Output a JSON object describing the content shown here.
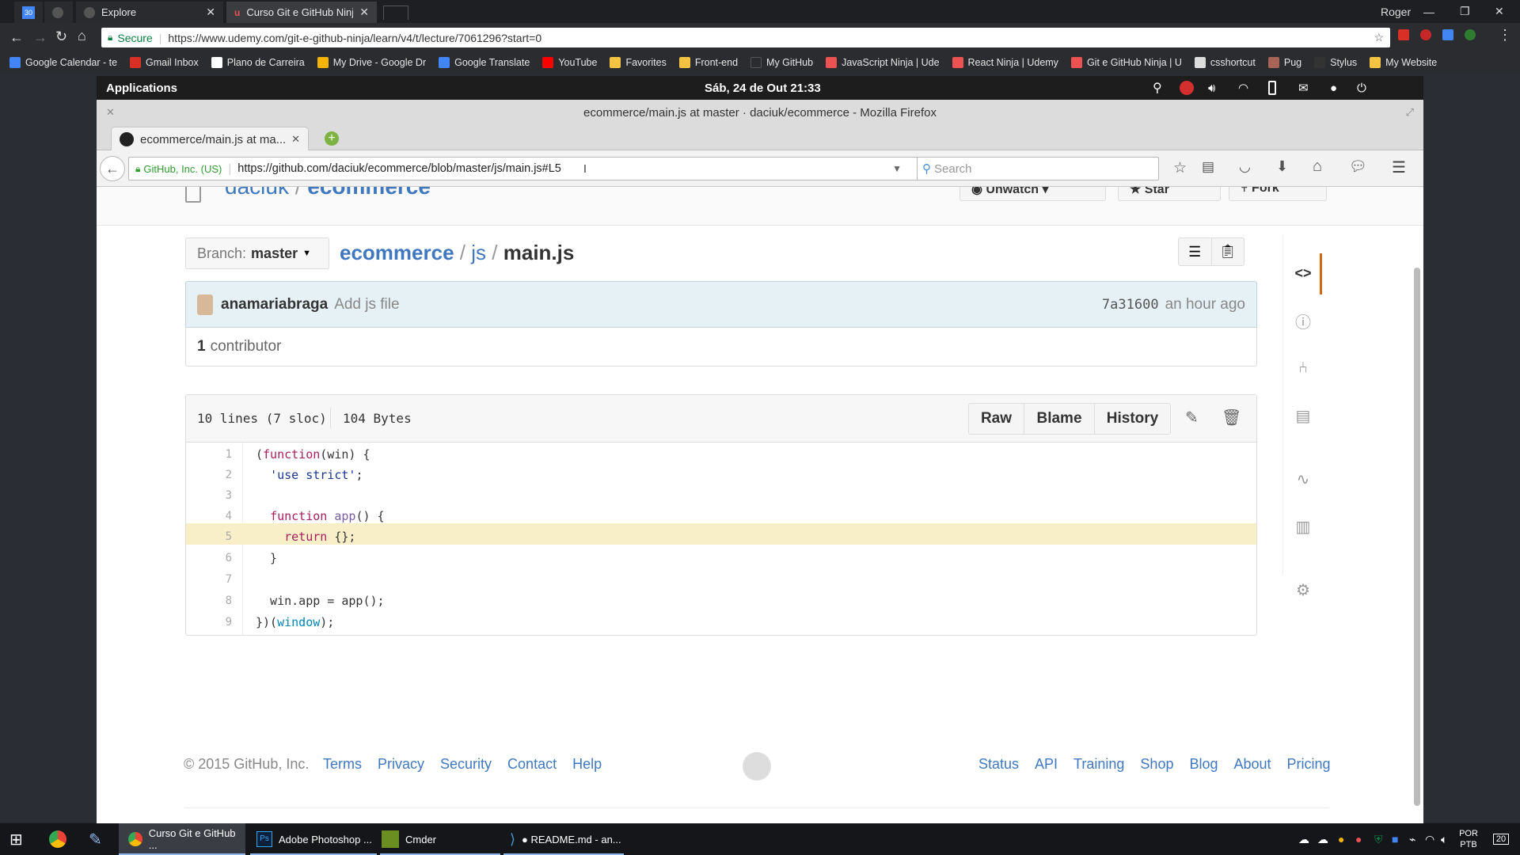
{
  "chrome": {
    "tabs": [
      {
        "label": ""
      },
      {
        "label": ""
      },
      {
        "label": "Explore"
      },
      {
        "label": "Curso Git e GitHub Ninja"
      }
    ],
    "user": "Roger",
    "secure_label": "Secure",
    "url": "https://www.udemy.com/git-e-github-ninja/learn/v4/t/lecture/7061296?start=0",
    "bookmarks": [
      {
        "label": "Google Calendar - te",
        "color": "#4285f4"
      },
      {
        "label": "Gmail Inbox",
        "color": "#d93025"
      },
      {
        "label": "Plano de Carreira",
        "color": "#ffffff"
      },
      {
        "label": "My Drive - Google Dr",
        "color": "#f4b400"
      },
      {
        "label": "Google Translate",
        "color": "#4285f4"
      },
      {
        "label": "YouTube",
        "color": "#ff0000"
      },
      {
        "label": "Favorites",
        "color": "#f5c342"
      },
      {
        "label": "Front-end",
        "color": "#f5c342"
      },
      {
        "label": "My GitHub",
        "color": "#2b2c2f"
      },
      {
        "label": "JavaScript Ninja | Ude",
        "color": "#ec5252"
      },
      {
        "label": "React Ninja | Udemy",
        "color": "#ec5252"
      },
      {
        "label": "Git e GitHub Ninja | U",
        "color": "#ec5252"
      },
      {
        "label": "csshortcut",
        "color": "#dddddd"
      },
      {
        "label": "Pug",
        "color": "#a86454"
      },
      {
        "label": "Stylus",
        "color": "#333333"
      },
      {
        "label": "My Website",
        "color": "#f5c342"
      }
    ]
  },
  "gnome": {
    "applications": "Applications",
    "clock": "Sáb, 24 de Out 21:33"
  },
  "firefox": {
    "window_title": "ecommerce/main.js at master · daciuk/ecommerce - Mozilla Firefox",
    "tab_title": "ecommerce/main.js at ma...",
    "identity": "GitHub, Inc. (US)",
    "url": "https://github.com/daciuk/ecommerce/blob/master/js/main.js#L5",
    "search_placeholder": "Search"
  },
  "github": {
    "repo_owner": "daciuk",
    "repo_sep": "/",
    "repo_name": "ecommerce",
    "watch_label": "Unwatch",
    "star_label": "Star",
    "fork_label": "Fork",
    "branch_prefix": "Branch:",
    "branch": "master",
    "breadcrumb": {
      "repo": "ecommerce",
      "sep1": "/",
      "dir": "js",
      "sep2": "/",
      "file": "main.js"
    },
    "commit": {
      "author": "anamariabraga",
      "message": "Add js file",
      "sha": "7a31600",
      "time": "an hour ago"
    },
    "contributors": {
      "count": "1",
      "label": "contributor"
    },
    "file_info": {
      "lines": "10 lines (7 sloc)",
      "size": "104 Bytes"
    },
    "actions": {
      "raw": "Raw",
      "blame": "Blame",
      "history": "History"
    },
    "code": [
      {
        "n": "1",
        "text": "(function(win) {"
      },
      {
        "n": "2",
        "text": "  'use strict';"
      },
      {
        "n": "3",
        "text": ""
      },
      {
        "n": "4",
        "text": "  function app() {"
      },
      {
        "n": "5",
        "text": "    return {};"
      },
      {
        "n": "6",
        "text": "  }"
      },
      {
        "n": "7",
        "text": ""
      },
      {
        "n": "8",
        "text": "  win.app = app();"
      },
      {
        "n": "9",
        "text": "})(window);"
      }
    ],
    "highlighted_line": "5",
    "footer": {
      "copyright": "© 2015 GitHub, Inc.",
      "left_links": [
        "Terms",
        "Privacy",
        "Security",
        "Contact",
        "Help"
      ],
      "right_links": [
        "Status",
        "API",
        "Training",
        "Shop",
        "Blog",
        "About",
        "Pricing"
      ]
    }
  },
  "taskbar": {
    "apps": [
      {
        "label": "Curso Git e GitHub ..."
      },
      {
        "label": "Adobe Photoshop ..."
      },
      {
        "label": "Cmder"
      },
      {
        "label": "● README.md - an..."
      }
    ],
    "lang_top": "POR",
    "lang_bottom": "PTB",
    "notifications": "20"
  },
  "colors": {
    "link": "#4078c0",
    "highlight": "#f8eec7",
    "commit_bg": "#e6f1f6"
  }
}
